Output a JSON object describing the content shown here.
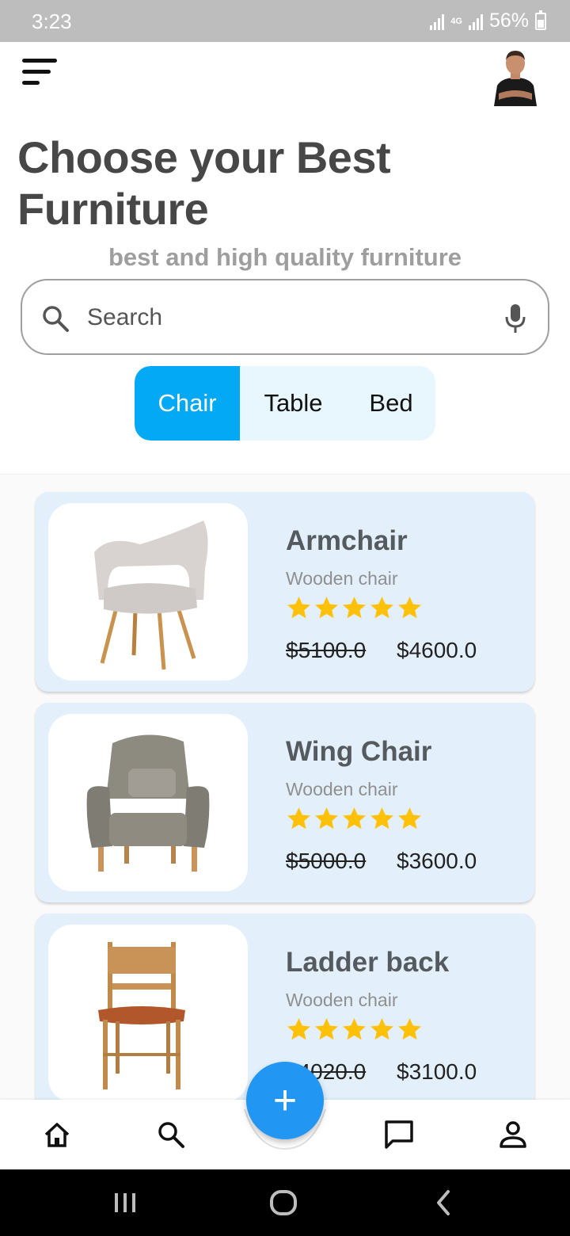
{
  "status_bar": {
    "time": "3:23",
    "network": "4G",
    "battery": "56%"
  },
  "header": {
    "menu_icon": "menu-icon",
    "avatar": "profile-avatar"
  },
  "hero": {
    "title": "Choose your Best Furniture",
    "subtitle": "best and high quality furniture"
  },
  "search": {
    "placeholder": "Search",
    "value": "",
    "icon": "search-icon",
    "mic_icon": "mic-icon"
  },
  "tabs": [
    {
      "label": "Chair",
      "active": true
    },
    {
      "label": "Table",
      "active": false
    },
    {
      "label": "Bed",
      "active": false
    }
  ],
  "products": [
    {
      "name": "Armchair",
      "material": "Wooden chair",
      "rating": 5,
      "old_price": "$5100.0",
      "new_price": "$4600.0"
    },
    {
      "name": "Wing Chair",
      "material": "Wooden chair",
      "rating": 5,
      "old_price": "$5000.0",
      "new_price": "$3600.0"
    },
    {
      "name": "Ladder back",
      "material": "Wooden chair",
      "rating": 5,
      "old_price": "$4020.0",
      "new_price": "$3100.0"
    }
  ],
  "fab": {
    "label": "+"
  },
  "bottom_nav": [
    "home-icon",
    "search-icon",
    "chat-icon",
    "person-icon"
  ],
  "colors": {
    "accent": "#03a9f4",
    "fab": "#2196f3",
    "card_bg": "#e3f0fb",
    "star": "#ffc107"
  }
}
